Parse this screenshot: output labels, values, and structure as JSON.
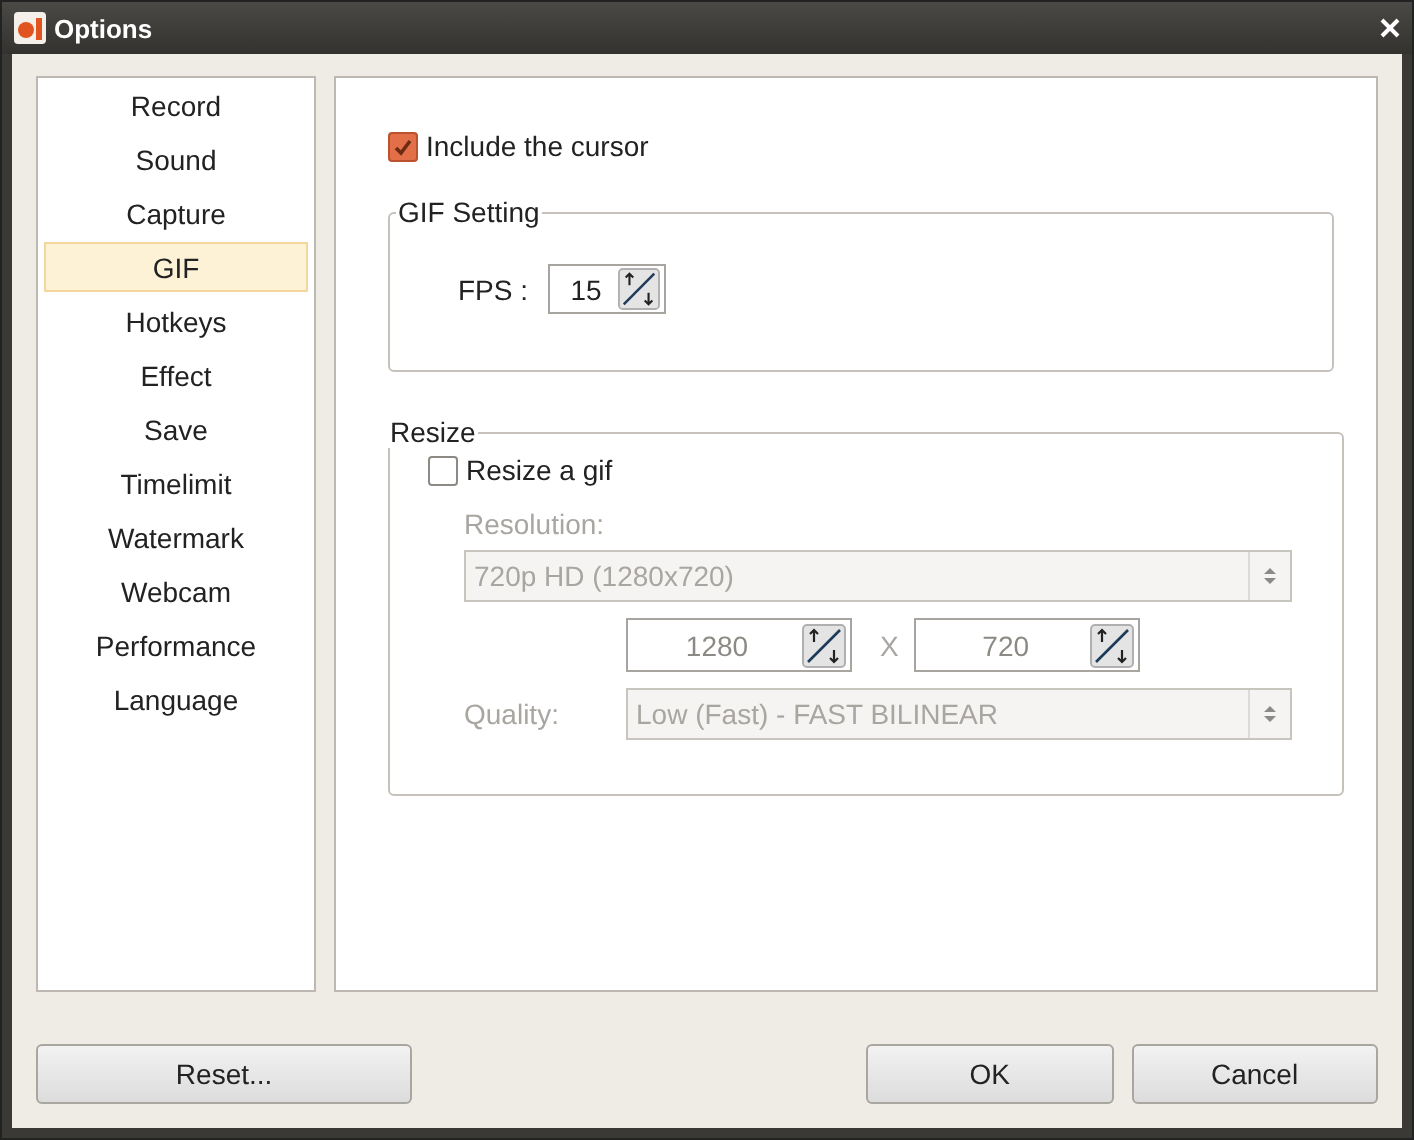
{
  "window": {
    "title": "Options"
  },
  "sidebar": {
    "items": [
      {
        "label": "Record",
        "selected": false
      },
      {
        "label": "Sound",
        "selected": false
      },
      {
        "label": "Capture",
        "selected": false
      },
      {
        "label": "GIF",
        "selected": true
      },
      {
        "label": "Hotkeys",
        "selected": false
      },
      {
        "label": "Effect",
        "selected": false
      },
      {
        "label": "Save",
        "selected": false
      },
      {
        "label": "Timelimit",
        "selected": false
      },
      {
        "label": "Watermark",
        "selected": false
      },
      {
        "label": "Webcam",
        "selected": false
      },
      {
        "label": "Performance",
        "selected": false
      },
      {
        "label": "Language",
        "selected": false
      }
    ]
  },
  "include_cursor": {
    "label": "Include the cursor",
    "checked": true
  },
  "gif_setting": {
    "title": "GIF Setting",
    "fps_label": "FPS :",
    "fps_value": "15"
  },
  "resize": {
    "title": "Resize",
    "checkbox": {
      "label": "Resize a gif",
      "checked": false
    },
    "disabled": true,
    "resolution_label": "Resolution:",
    "resolution_value": "720p HD (1280x720)",
    "width_value": "1280",
    "separator": "X",
    "height_value": "720",
    "quality_label": "Quality:",
    "quality_value": "Low (Fast) - FAST BILINEAR"
  },
  "footer": {
    "reset": "Reset...",
    "ok": "OK",
    "cancel": "Cancel"
  }
}
